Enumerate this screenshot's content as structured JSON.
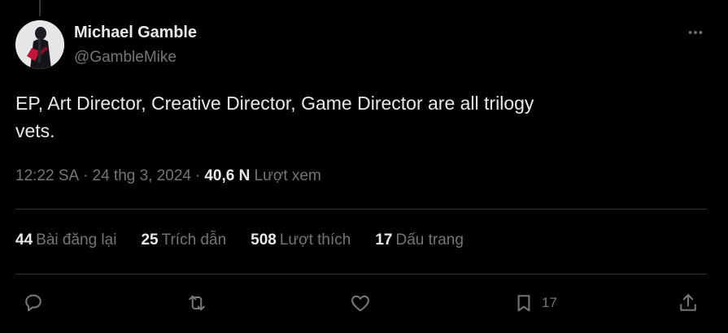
{
  "tweet": {
    "display_name": "Michael Gamble",
    "handle": "@GambleMike",
    "text": "EP, Art Director, Creative Director, Game Director are all trilogy vets.",
    "time": "12:22 SA",
    "date": "24 thg 3, 2024",
    "views_count": "40,6 N",
    "views_label": "Lượt xem"
  },
  "stats": [
    {
      "count": "44",
      "label": "Bài đăng lại"
    },
    {
      "count": "25",
      "label": "Trích dẫn"
    },
    {
      "count": "508",
      "label": "Lượt thích"
    },
    {
      "count": "17",
      "label": "Dấu trang"
    }
  ],
  "actions": {
    "bookmark_count": "17"
  },
  "icons": {
    "more": "more-horizontal-icon",
    "reply": "reply-bubble-icon",
    "repost": "repost-icon",
    "like": "heart-icon",
    "bookmark": "bookmark-icon",
    "share": "share-icon"
  },
  "colors": {
    "background": "#000000",
    "primary_text": "#e7e9ea",
    "secondary_text": "#71767b",
    "divider": "#2f3336"
  }
}
